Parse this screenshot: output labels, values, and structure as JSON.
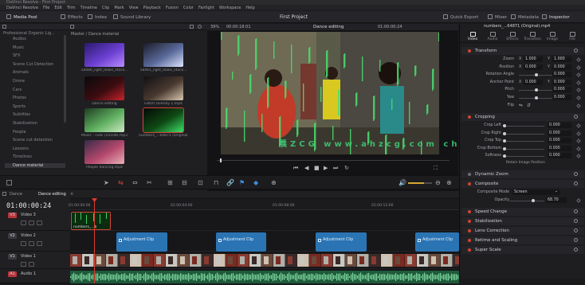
{
  "titlebar": {
    "title": "DaVinci Resolve - First Project"
  },
  "menubar": {
    "items": [
      "DaVinci Resolve",
      "File",
      "Edit",
      "Trim",
      "Timeline",
      "Clip",
      "Mark",
      "View",
      "Playback",
      "Fusion",
      "Color",
      "Fairlight",
      "Workspace",
      "Help"
    ]
  },
  "toolbar": {
    "left": [
      {
        "label": "Media Pool",
        "icon": "media-pool-icon",
        "active": true
      },
      {
        "label": "Effects",
        "icon": "effects-icon"
      },
      {
        "label": "Index",
        "icon": "index-icon"
      },
      {
        "label": "Sound Library",
        "icon": "sound-library-icon"
      }
    ],
    "project_title": "First Project",
    "right": [
      {
        "label": "Quick Export",
        "icon": "export-icon"
      },
      {
        "label": "Mixer",
        "icon": "mixer-icon"
      },
      {
        "label": "Metadata",
        "icon": "metadata-icon"
      },
      {
        "label": "Inspector",
        "icon": "inspector-icon",
        "active": true
      }
    ]
  },
  "media_pool": {
    "project_label": "Professional Organic Lig...",
    "path": "Master / Dance material",
    "bins": [
      "Audios",
      "Music",
      "SFX",
      "Scene Cut Detection",
      "Animals",
      "Drone",
      "Cars",
      "Photos",
      "Sports",
      "Subtitles",
      "Stabilization",
      "People",
      "Scene cut detection",
      "Lessons",
      "Timelines",
      "Dance material"
    ],
    "selected_bin": "Dance material",
    "clips": [
      {
        "label": "18486_light_leaks_stock...",
        "colors": [
          "#2a1a6e",
          "#6b3fd1",
          "#b98cff"
        ]
      },
      {
        "label": "18461_light_leaks_stock...",
        "colors": [
          "#1c1c28",
          "#5a6a9a",
          "#dde4ff"
        ]
      },
      {
        "label": "Dance editing",
        "colors": [
          "#0a0a0c",
          "#3a0c10",
          "#c8222c"
        ]
      },
      {
        "label": "Glitch Overlay 1.mp4",
        "colors": [
          "#101014",
          "#4a3a30",
          "#d8c8b0"
        ]
      },
      {
        "label": "Music - cute (10108).mp3",
        "colors": [
          "#1f3d22",
          "#5fb060",
          "#cfe8c4"
        ]
      },
      {
        "label": "numbers_...64871 (Original).mp4",
        "colors": [
          "#050805",
          "#0f4a14",
          "#3fe06a"
        ]
      },
      {
        "label": "People dancing.mp4",
        "colors": [
          "#3a2a48",
          "#b4486c",
          "#e8b0b8"
        ]
      }
    ]
  },
  "viewer": {
    "zoom": "39%",
    "source_tc": "00:00:18:01",
    "timeline_name": "Dance editing",
    "record_tc": "01:00:00:24",
    "watermark": "晨ZCG  www.ahzcg.com  ch"
  },
  "inspector": {
    "clip_name": "numbers_...64871 (Original).mp4",
    "tabs": [
      "Video",
      "Audio",
      "Effects",
      "Transition",
      "Image",
      "File"
    ],
    "active_tab": "Video",
    "transform": {
      "title": "Transform",
      "rows": [
        {
          "label": "Zoom",
          "x": "1.000",
          "y": "1.000",
          "xl": "X",
          "yl": "Y"
        },
        {
          "label": "Position",
          "x": "0.000",
          "y": "0.000",
          "xl": "X",
          "yl": "Y"
        },
        {
          "label": "Rotation Angle",
          "v": "0.000"
        },
        {
          "label": "Anchor Point",
          "x": "0.000",
          "y": "0.000",
          "xl": "X",
          "yl": "Y"
        },
        {
          "label": "Pitch",
          "v": "0.000"
        },
        {
          "label": "Yaw",
          "v": "0.000"
        },
        {
          "label": "Flip"
        }
      ]
    },
    "cropping": {
      "title": "Cropping",
      "rows": [
        {
          "label": "Crop Left",
          "v": "0.000"
        },
        {
          "label": "Crop Right",
          "v": "0.000"
        },
        {
          "label": "Crop Top",
          "v": "0.000"
        },
        {
          "label": "Crop Bottom",
          "v": "0.000"
        },
        {
          "label": "Softness",
          "v": "0.000"
        }
      ],
      "retain": "Retain Image Position"
    },
    "dynamic_zoom": "Dynamic Zoom",
    "composite": {
      "title": "Composite",
      "mode_label": "Composite Mode",
      "mode": "Screen",
      "opacity_label": "Opacity",
      "opacity": "68.70",
      "opacity_level": 0.687
    },
    "collapsed": [
      "Speed Change",
      "Stabilization",
      "Lens Correction",
      "Retime and Scaling",
      "Super Scale"
    ]
  },
  "timeline": {
    "tabs": [
      "Dance",
      "Dance editing"
    ],
    "active_tab": "Dance editing",
    "timecode": "01:00:00:24",
    "ruler": [
      "01:00:00:00",
      "01:00:04:00",
      "01:00:08:00",
      "01:00:12:00"
    ],
    "tracks": [
      {
        "id": "V3",
        "name": "Video 3",
        "color": "#b8353a"
      },
      {
        "id": "V2",
        "name": "Video 2",
        "color": "#3a3a40"
      },
      {
        "id": "V1",
        "name": "Video 1",
        "color": "#3a3a40"
      },
      {
        "id": "A1",
        "name": "Audio 1",
        "color": "#b8353a"
      }
    ],
    "v3_clip": "numbers_...b",
    "adjustment_label": "Adjustment Clip",
    "adjustment_count": 4
  }
}
